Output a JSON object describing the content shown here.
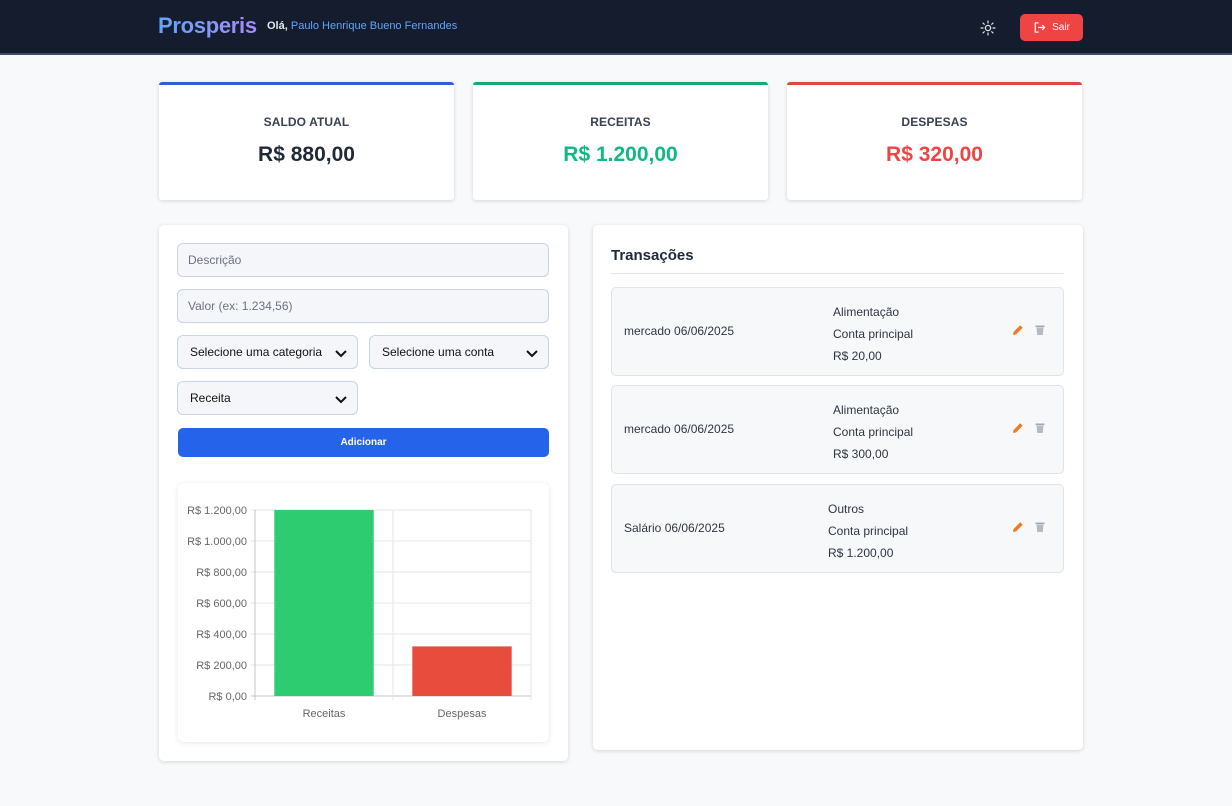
{
  "header": {
    "brand": "Prosperis",
    "greeting": "Olá,",
    "user_name": "Paulo Henrique Bueno Fernandes",
    "theme_icon": "sun-icon",
    "logout_label": "Sair",
    "logout_icon": "logout-icon"
  },
  "summary": {
    "balance": {
      "label": "SALDO ATUAL",
      "value": "R$ 880,00",
      "color": "#1f2937",
      "accent": "#2f5fd0"
    },
    "income": {
      "label": "RECEITAS",
      "value": "R$ 1.200,00",
      "color": "#10b981",
      "accent": "#19a777"
    },
    "expense": {
      "label": "DESPESAS",
      "value": "R$ 320,00",
      "color": "#ef4444",
      "accent": "#e04444"
    }
  },
  "form": {
    "description_placeholder": "Descrição",
    "value_placeholder": "Valor (ex: 1.234,56)",
    "category_select": "Selecione uma categoria",
    "account_select": "Selecione uma conta",
    "type_select": "Receita",
    "add_label": "Adicionar"
  },
  "chart_data": {
    "type": "bar",
    "categories": [
      "Receitas",
      "Despesas"
    ],
    "values": [
      1200,
      320
    ],
    "colors": [
      "#2ecc71",
      "#e74c3c"
    ],
    "ylim": [
      0,
      1200
    ],
    "yticks": [
      0,
      200,
      400,
      600,
      800,
      1000,
      1200
    ],
    "ytick_labels": [
      "R$ 0,00",
      "R$ 200,00",
      "R$ 400,00",
      "R$ 600,00",
      "R$ 800,00",
      "R$ 1.000,00",
      "R$ 1.200,00"
    ],
    "grid": true
  },
  "transactions": {
    "title": "Transações",
    "items": [
      {
        "description": "mercado 06/06/2025",
        "category": "Alimentação",
        "account": "Conta principal",
        "amount": "R$ 20,00"
      },
      {
        "description": "mercado 06/06/2025",
        "category": "Alimentação",
        "account": "Conta principal",
        "amount": "R$ 300,00"
      },
      {
        "description": "Salário 06/06/2025",
        "category": "Outros",
        "account": "Conta principal",
        "amount": "R$ 1.200,00"
      }
    ],
    "edit_icon": "pencil-icon",
    "delete_icon": "trash-icon"
  }
}
